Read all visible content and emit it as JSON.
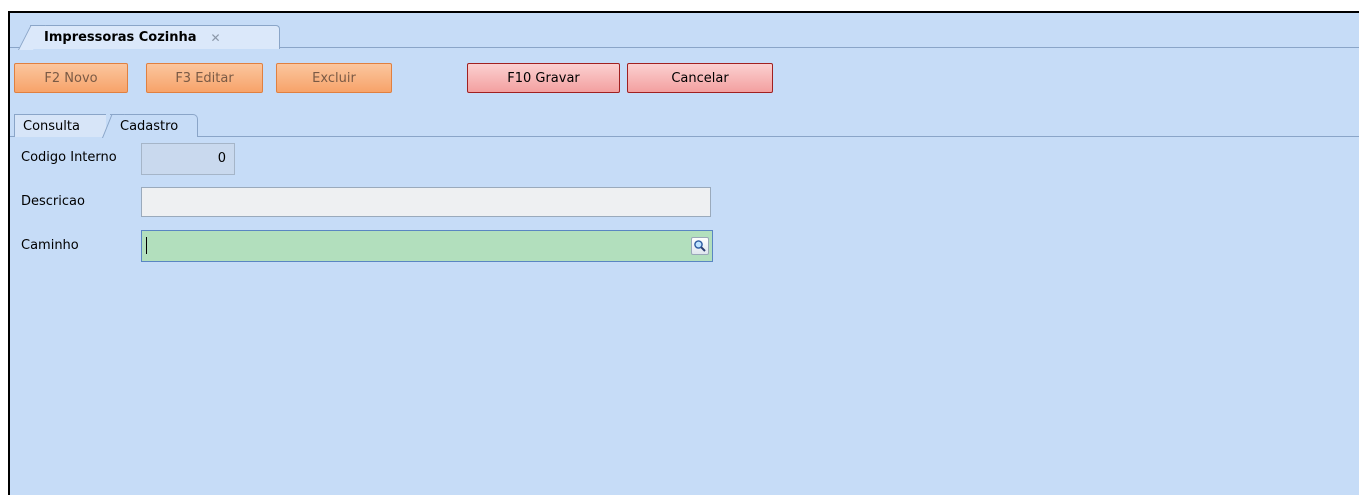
{
  "document_tab": {
    "title": "Impressoras Cozinha",
    "close_glyph": "✕"
  },
  "toolbar": {
    "novo_label": "F2 Novo",
    "editar_label": "F3 Editar",
    "excluir_label": "Excluir",
    "gravar_label": "F10 Gravar",
    "cancelar_label": "Cancelar"
  },
  "tabs": [
    {
      "label": "Consulta"
    },
    {
      "label": "Cadastro"
    }
  ],
  "form": {
    "codigo_label": "Codigo Interno",
    "codigo_value": "0",
    "descricao_label": "Descricao",
    "descricao_value": "",
    "caminho_label": "Caminho",
    "caminho_value": ""
  },
  "colors": {
    "background": "#c6dcf7",
    "disabled_button": "#f7a36a",
    "active_button": "#f3a0a0",
    "focused_field": "#b2dfbd"
  },
  "icons": {
    "search": "magnifier-icon",
    "close": "close-icon"
  }
}
